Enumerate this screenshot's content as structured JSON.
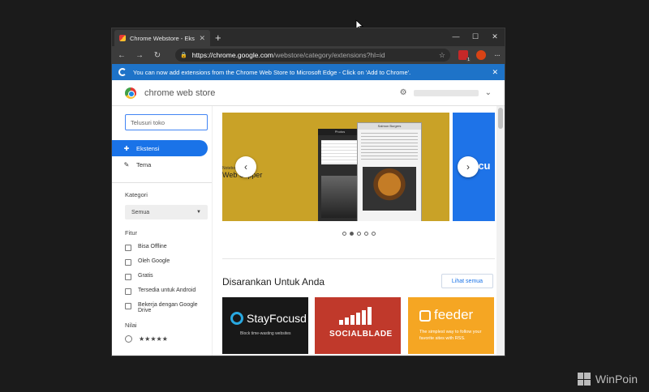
{
  "browser": {
    "tab_title": "Chrome Webstore - Ekstensi",
    "tab_close": "✕",
    "new_tab": "+",
    "controls": {
      "minimize": "—",
      "maximize": "☐",
      "close": "✕"
    },
    "url_host": "https://chrome.google.com",
    "url_rest": "/webstore/category/extensions?hl=id",
    "ext_badge": "1"
  },
  "infobar": {
    "message": "You can now add extensions from the Chrome Web Store to Microsoft Edge - Click on 'Add to Chrome'.",
    "close": "✕"
  },
  "store": {
    "title": "chrome web store"
  },
  "sidebar": {
    "search_placeholder": "Telusuri toko",
    "nav": [
      {
        "label": "Ekstensi"
      },
      {
        "label": "Tema"
      }
    ],
    "kategori_heading": "Kategori",
    "kategori_value": "Semua",
    "fitur_heading": "Fitur",
    "fitur": [
      {
        "label": "Bisa Offline"
      },
      {
        "label": "Oleh Google"
      },
      {
        "label": "Gratis"
      },
      {
        "label": "Tersedia untuk Android"
      },
      {
        "label": "Bekerja dengan Google Drive"
      }
    ],
    "nilai_heading": "Nilai",
    "rating_stars": "★★★★★"
  },
  "carousel": {
    "slide_small": "Notebook",
    "slide_text": "Web Clipper",
    "mock_header_1": "Photos",
    "mock_header_2": "Salmon Burgers",
    "next_slide_text": "Docu",
    "prev": "‹",
    "next": "›",
    "active_index": 1,
    "count": 5
  },
  "recommended": {
    "title": "Disarankan Untuk Anda",
    "see_all": "Lihat semua",
    "cards": [
      {
        "name": "StayFocusd",
        "tagline": "Block time-wasting websites"
      },
      {
        "name": "SOCIALBLADE"
      },
      {
        "name": "feeder",
        "tagline": "The simplest way to follow your favorite sites with RSS."
      }
    ]
  },
  "watermark": "WinPoin",
  "colors": {
    "accent": "#1a73e8",
    "infobar": "#1e73c8",
    "carousel_bg": "#c9a227"
  }
}
